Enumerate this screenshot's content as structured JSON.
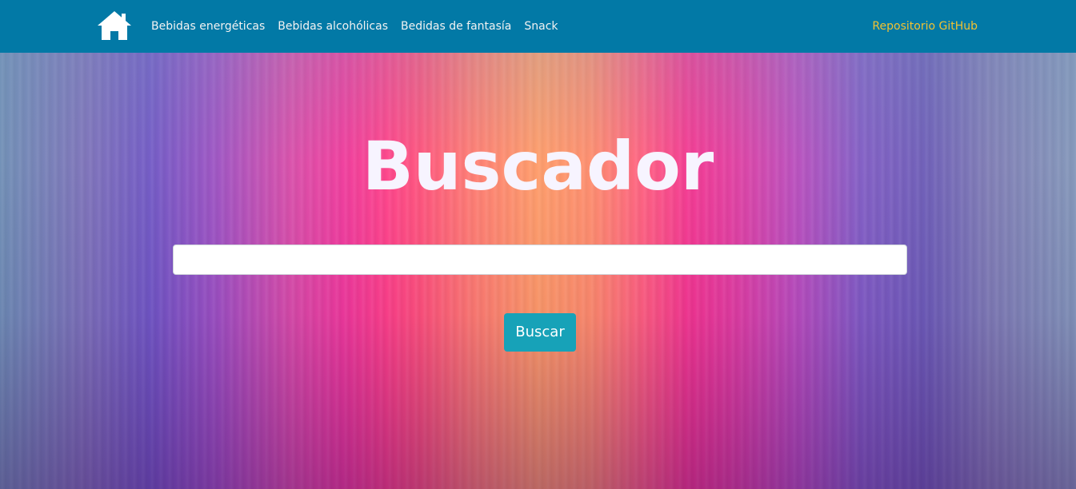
{
  "navbar": {
    "home_icon": "home-icon",
    "links": [
      {
        "label": "Bebidas energéticas"
      },
      {
        "label": "Bebidas alcohólicas"
      },
      {
        "label": "Bedidas de fantasía"
      },
      {
        "label": "Snack"
      }
    ],
    "github_label": "Repositorio GitHub",
    "background_color": "#0279a6",
    "github_color": "#f1c232"
  },
  "hero": {
    "title": "Buscador",
    "search": {
      "value": "",
      "placeholder": ""
    },
    "button_label": "Buscar",
    "button_color": "#17a2b8"
  }
}
